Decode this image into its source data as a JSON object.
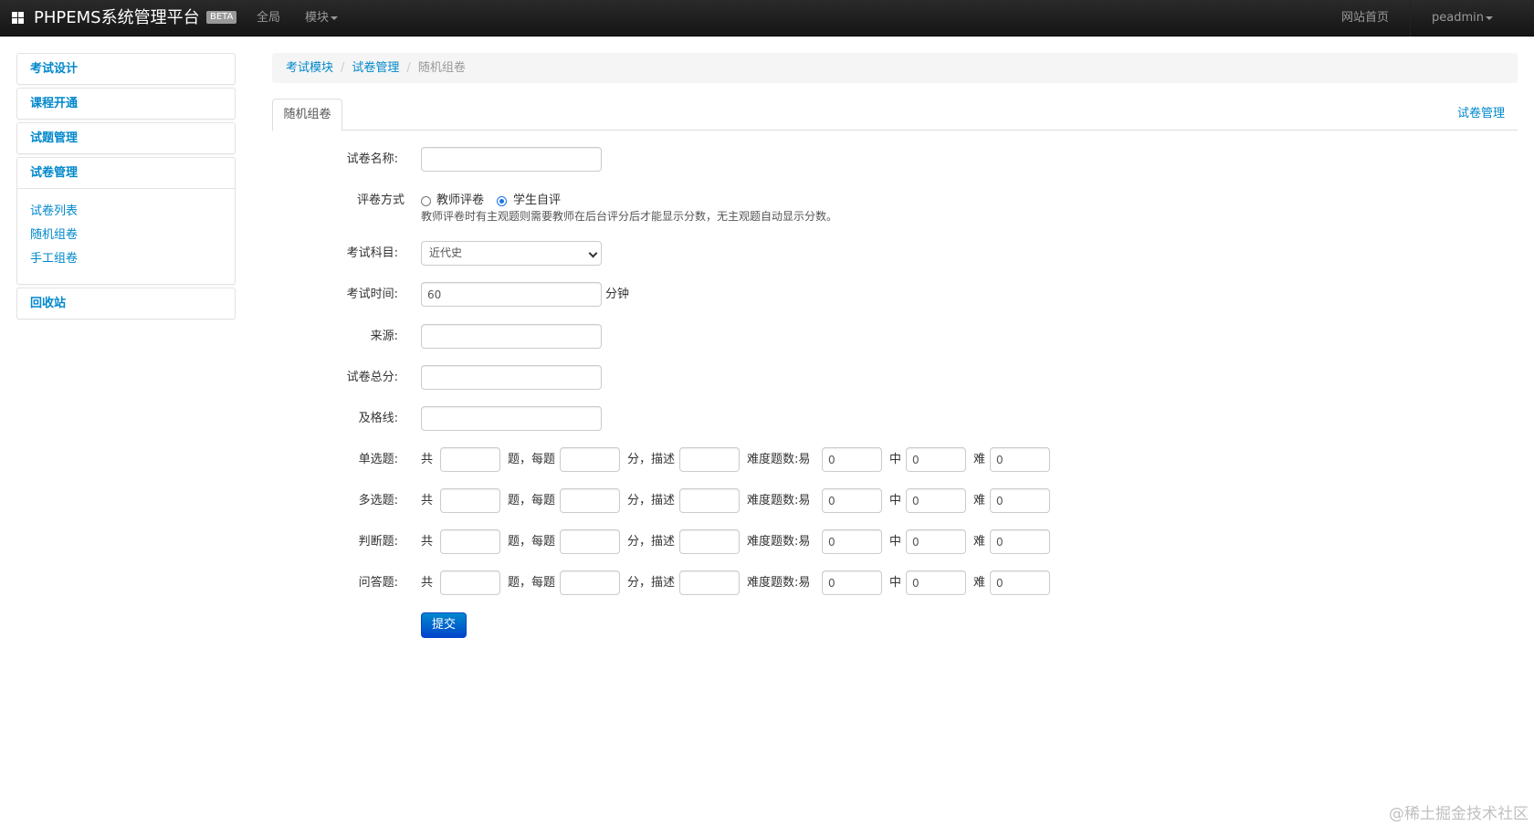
{
  "navbar": {
    "brand": "PHPEMS系统管理平台",
    "badge": "BETA",
    "items": [
      "全局",
      "模块"
    ],
    "right_items": [
      "网站首页",
      "peadmin"
    ]
  },
  "sidebar": {
    "items": [
      "考试设计",
      "课程开通",
      "试题管理",
      "试卷管理"
    ],
    "sub_items": [
      "试卷列表",
      "随机组卷",
      "手工组卷"
    ],
    "recycle": "回收站"
  },
  "breadcrumb": [
    "考试模块",
    "试卷管理",
    "随机组卷"
  ],
  "tabs": {
    "active": "随机组卷",
    "right_link": "试卷管理"
  },
  "form": {
    "name_label": "试卷名称:",
    "grading_label": "评卷方式",
    "grading_options": [
      "教师评卷",
      "学生自评"
    ],
    "grading_selected": "学生自评",
    "grading_help": "教师评卷时有主观题则需要教师在后台评分后才能显示分数，无主观题自动显示分数。",
    "subject_label": "考试科目:",
    "subject_value": "近代史",
    "time_label": "考试时间:",
    "time_value": "60",
    "time_unit": "分钟",
    "source_label": "来源:",
    "total_label": "试卷总分:",
    "pass_label": "及格线:",
    "row_words": {
      "total": "共",
      "count_each": "题，每题",
      "score_desc": "分，描述",
      "difficulty": "难度题数:易",
      "medium": "中",
      "hard": "难"
    },
    "question_rows": [
      {
        "label": "单选题:",
        "easy": "0",
        "medium": "0",
        "hard": "0"
      },
      {
        "label": "多选题:",
        "easy": "0",
        "medium": "0",
        "hard": "0"
      },
      {
        "label": "判断题:",
        "easy": "0",
        "medium": "0",
        "hard": "0"
      },
      {
        "label": "问答题:",
        "easy": "0",
        "medium": "0",
        "hard": "0"
      }
    ],
    "submit": "提交"
  },
  "watermark": "@稀土掘金技术社区"
}
